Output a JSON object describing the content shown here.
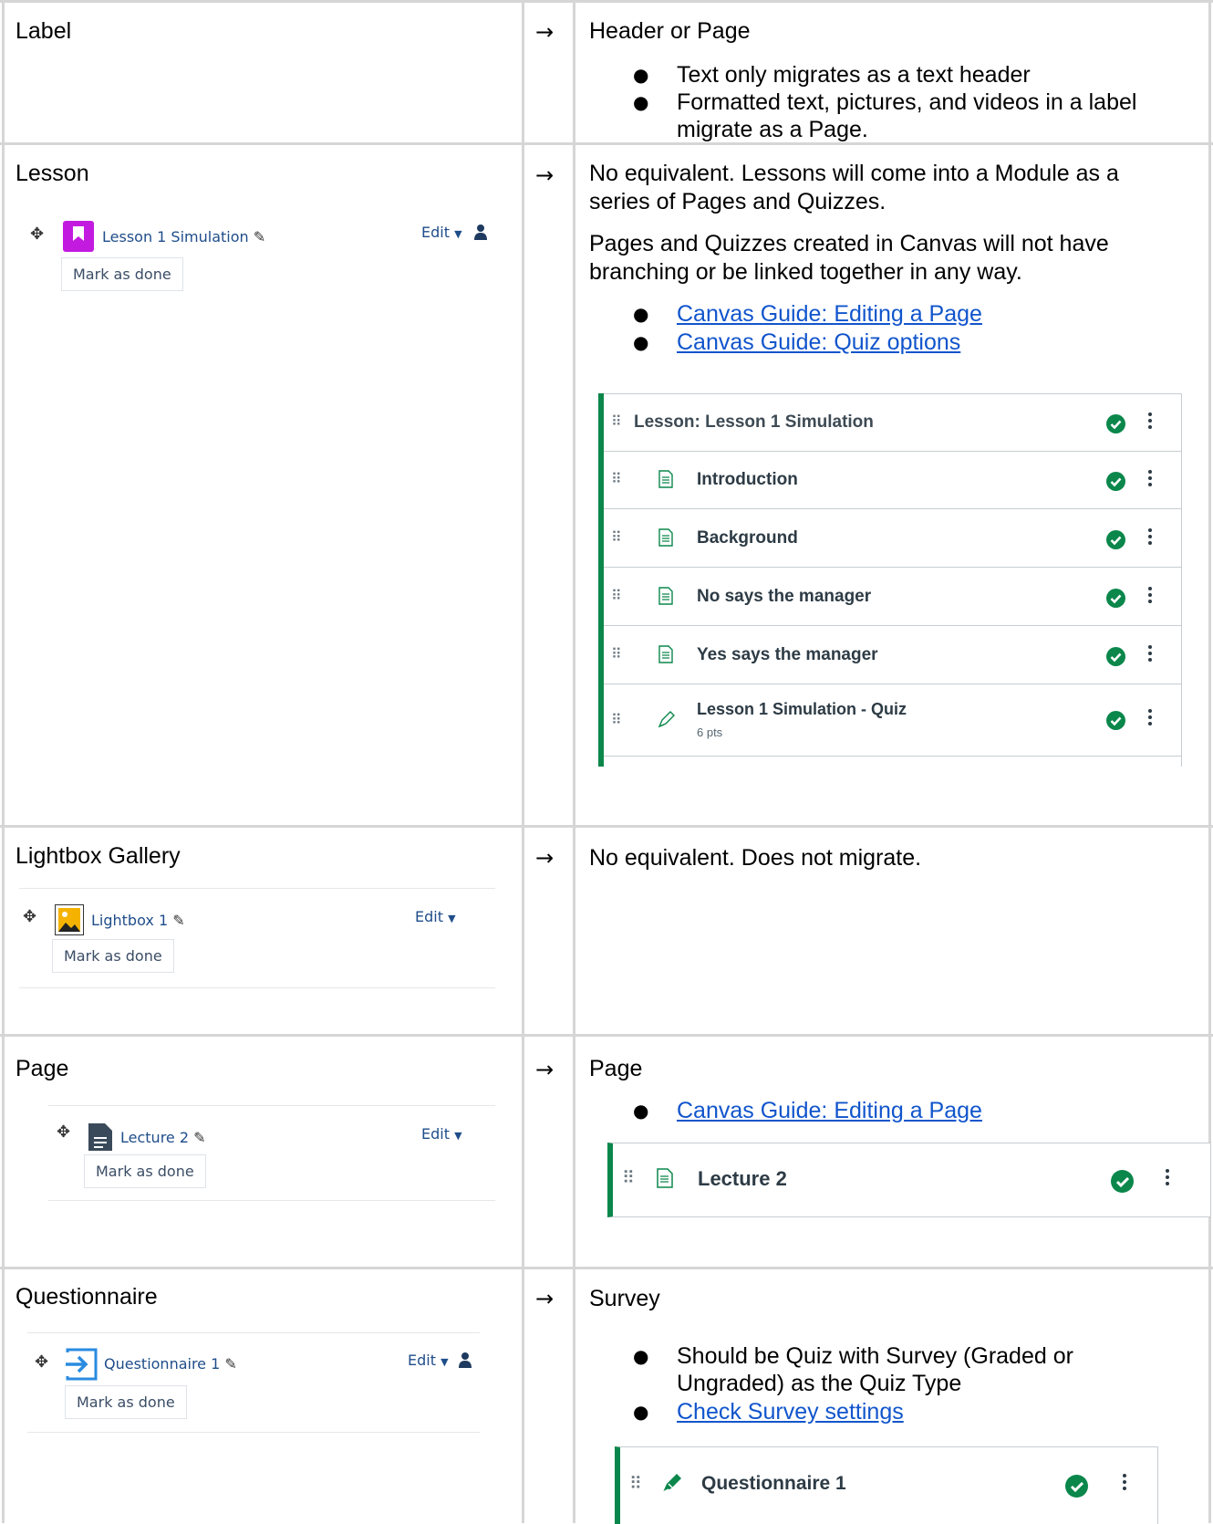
{
  "rows": [
    {
      "moodle_label": "Label",
      "arrow": "→",
      "canvas_title": "Header or Page",
      "bullets": [
        "Text only migrates as a text header",
        "Formatted text, pictures, and videos in a label",
        "migrate as a Page."
      ]
    },
    {
      "moodle_label": "Lesson",
      "arrow": "→",
      "canvas_text1_l1": "No equivalent. Lessons will come into a Module as a",
      "canvas_text1_l2": "series of Pages and Quizzes.",
      "canvas_text2_l1": "Pages and Quizzes created in Canvas will not have",
      "canvas_text2_l2": "branching or be linked together in any way.",
      "links": [
        "Canvas Guide: Editing a Page",
        "Canvas Guide: Quiz options"
      ],
      "moodle_item": {
        "label": "Lesson 1 Simulation",
        "edit": "Edit",
        "mark": "Mark as done",
        "icon": "lesson-icon"
      },
      "module": {
        "header": "Lesson: Lesson 1 Simulation",
        "items": [
          {
            "title": "Introduction",
            "icon": "page-icon"
          },
          {
            "title": "Background",
            "icon": "page-icon"
          },
          {
            "title": "No says the manager",
            "icon": "page-icon"
          },
          {
            "title": "Yes says the manager",
            "icon": "page-icon"
          },
          {
            "title": "Lesson 1 Simulation - Quiz",
            "sub": "6 pts",
            "icon": "quiz-icon"
          }
        ]
      }
    },
    {
      "moodle_label": "Lightbox Gallery",
      "arrow": "→",
      "canvas_text": "No equivalent. Does not migrate.",
      "moodle_item": {
        "label": "Lightbox 1",
        "edit": "Edit",
        "mark": "Mark as done",
        "icon": "image-icon"
      }
    },
    {
      "moodle_label": "Page",
      "arrow": "→",
      "canvas_title": "Page",
      "links": [
        "Canvas Guide: Editing a Page"
      ],
      "moodle_item": {
        "label": "Lecture 2",
        "edit": "Edit",
        "mark": "Mark as done",
        "icon": "file-icon"
      },
      "module_item": {
        "title": "Lecture 2",
        "icon": "page-icon"
      }
    },
    {
      "moodle_label": "Questionnaire",
      "arrow": "→",
      "canvas_title": "Survey",
      "bullet_l1": "Should be Quiz with Survey (Graded or",
      "bullet_l2": "Ungraded) as the Quiz Type",
      "links": [
        "Check Survey settings"
      ],
      "moodle_item": {
        "label": "Questionnaire 1",
        "edit": "Edit",
        "mark": "Mark as done",
        "icon": "enter-icon"
      },
      "module_item": {
        "title": "Questionnaire 1",
        "icon": "quiz-icon"
      }
    }
  ]
}
